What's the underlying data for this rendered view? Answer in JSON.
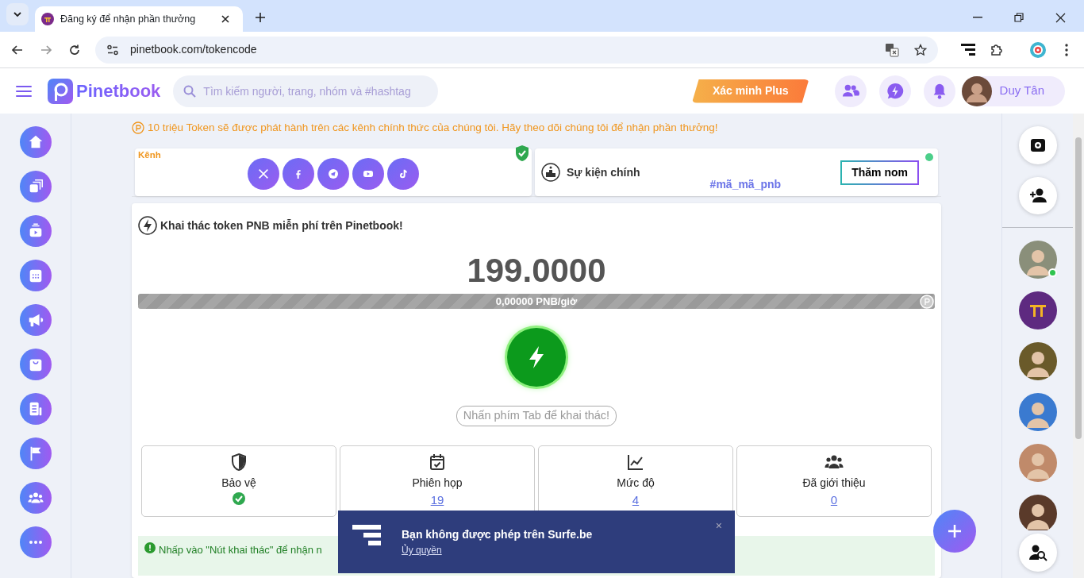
{
  "browser": {
    "tab_title": "Đăng ký để nhận phần thưởng",
    "url": "pinetbook.com/tokencode"
  },
  "header": {
    "brand": "Pinetbook",
    "search": {
      "placeholder": "Tìm kiếm người, trang, nhóm và #hashtag"
    },
    "verify_button": "Xác minh Plus",
    "user_name": "Duy Tân"
  },
  "notice": "10 triệu Token sẽ được phát hành trên các kênh chính thức của chúng tôi. Hãy theo dõi chúng tôi để nhận phần thưởng!",
  "channels": {
    "label": "Kênh",
    "verified": true
  },
  "event": {
    "title": "Sự kiện chính",
    "hashtag": "#mã_mã_pnb",
    "button": "Thăm nom",
    "live": true
  },
  "mining": {
    "title": "Khai thác token PNB miễn phí trên Pinetbook!",
    "balance": "199.0000",
    "rate": "0,00000 PNB/giờ",
    "hint": "Nhấn phím Tab để khai thác!",
    "stats": [
      {
        "label": "Bảo vệ",
        "kind": "check"
      },
      {
        "label": "Phiên họp",
        "kind": "link",
        "value": "19"
      },
      {
        "label": "Mức độ",
        "kind": "link",
        "value": "4"
      },
      {
        "label": "Đã giới thiệu",
        "kind": "link",
        "value": "0"
      }
    ],
    "banner": "Nhấp vào \"Nút khai thác\" để nhận n"
  },
  "contacts": [
    {
      "kind": "photo",
      "online": true
    },
    {
      "kind": "logo",
      "online": false
    },
    {
      "kind": "photo",
      "online": false
    },
    {
      "kind": "photo",
      "online": false
    },
    {
      "kind": "photo",
      "online": false
    },
    {
      "kind": "photo",
      "online": false
    }
  ],
  "toast": {
    "message": "Bạn không được phép trên Surfe.be",
    "link": "Ủy quyền",
    "close": "×"
  }
}
